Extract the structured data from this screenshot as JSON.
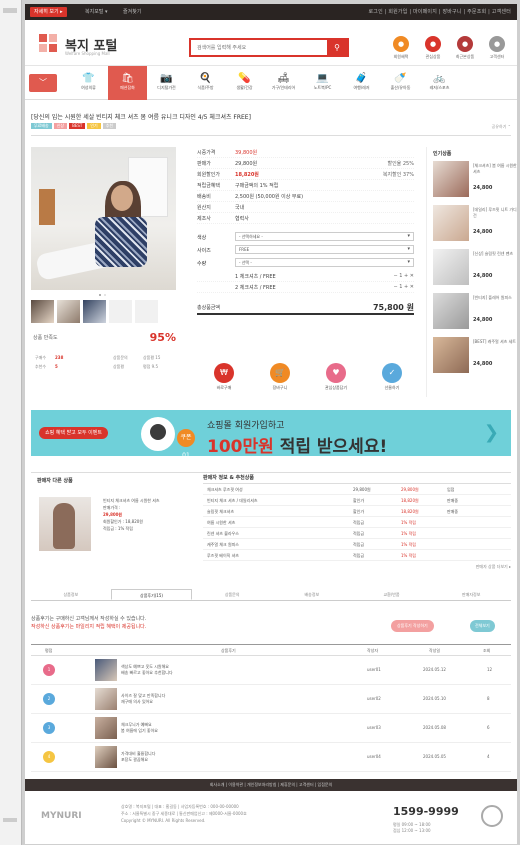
{
  "top_bar": {
    "tag": "자세히 보기 ▸",
    "left_links": [
      "복지포털 ▾",
      "즐겨찾기"
    ],
    "right_links": "로그인 | 회원가입 | 마이페이지 | 장바구니 | 주문조회 | 고객센터"
  },
  "header": {
    "brand": "복지 포털",
    "brand_sub": "Welfare Shopping Mall",
    "search_placeholder": "검색어를 입력해 주세요",
    "icons": [
      {
        "label": "회원혜택",
        "color": "#f08a24"
      },
      {
        "label": "관심상품",
        "color": "#d9342b"
      },
      {
        "label": "최근본상품",
        "color": "#b43a3a"
      },
      {
        "label": "고객센터",
        "color": "#999999"
      }
    ]
  },
  "categories": [
    "여성의류",
    "패션잡화",
    "디지털가전",
    "식품/주방",
    "생활/건강",
    "가구/인테리어",
    "노트북/PC",
    "여행/레저",
    "출산/유아동",
    "레저/스포츠"
  ],
  "product": {
    "title": "[당신의 입는 시원한 세살 빈티지 체크 셔츠 봄 여름 유니크 디자인 4/5 체크셔츠 FREE]",
    "badges": [
      {
        "text": "무료배송",
        "color": "#7fc9d4"
      },
      {
        "text": "신상",
        "color": "#f3a0a0"
      },
      {
        "text": "BEST",
        "color": "#d9342b"
      },
      {
        "text": "인기",
        "color": "#f5c542"
      },
      {
        "text": "추천",
        "color": "#ccc"
      }
    ],
    "share": "공유하기 ⌃",
    "like_label": "상품 만족도",
    "like_pct": "95%",
    "stats": [
      {
        "k": "구매수",
        "v": "238",
        "k2": "상품문의",
        "v2": "상품평 15"
      },
      {
        "k": "추천수",
        "v": "5",
        "k2": "상품평",
        "v2": "평점 9.5"
      }
    ],
    "info_rows": [
      {
        "k": "시중가격",
        "v": "39,800원",
        "r": ""
      },
      {
        "k": "판매가",
        "v": "29,800원",
        "r": "할인율 25%"
      },
      {
        "k": "회원할인가",
        "v": "18,820원",
        "r": "복지할인 37%"
      },
      {
        "k": "적립금혜택",
        "v": "구매금액의 1% 적립",
        "r": ""
      },
      {
        "k": "배송비",
        "v": "2,500원 (50,000원 이상 무료)",
        "r": ""
      },
      {
        "k": "원산지",
        "v": "국내",
        "r": ""
      },
      {
        "k": "제조사",
        "v": "협력사",
        "r": ""
      }
    ],
    "options": [
      {
        "k": "색상",
        "v": "- 선택하세요 -"
      },
      {
        "k": "사이즈",
        "v": "FREE"
      },
      {
        "k": "수량",
        "v": "- 선택 -"
      }
    ],
    "qty_rows": [
      "1 체크셔츠 / FREE",
      "2 체크셔츠 / FREE"
    ],
    "total_label": "총상품금액",
    "total_value": "75,800 원",
    "actions": [
      {
        "label": "바로구매",
        "color": "#d9342b"
      },
      {
        "label": "장바구니",
        "color": "#f08a24"
      },
      {
        "label": "관심상품담기",
        "color": "#e86b8a"
      },
      {
        "label": "선물하기",
        "color": "#5aa9dc"
      }
    ]
  },
  "recommend": {
    "title": "인기상품",
    "items": [
      {
        "t": "[체크셔츠] 봄 여름 시원한 셔츠",
        "p": "24,800"
      },
      {
        "t": "[데일리] 루즈핏 니트 가디건",
        "p": "24,800"
      },
      {
        "t": "[신상] 슬림핏 린넨 팬츠",
        "p": "24,800"
      },
      {
        "t": "[빈티지] 플레어 원피스",
        "p": "24,800"
      },
      {
        "t": "[BEST] 캐주얼 셔츠 세트",
        "p": "24,800"
      }
    ]
  },
  "banner": {
    "pill": "쇼핑 혜택 받고 모두 이벤트",
    "coupon": "쿠폰 01",
    "line1": "쇼핑몰 회원가입하고",
    "line2_a": "100만원",
    "line2_b": " 적립 받으세요!"
  },
  "lower": {
    "title": "판매자 다른 상품",
    "desc": [
      "빈티지 체크셔츠 여름 시원한 셔츠",
      "판매가격 :",
      "29,800원",
      "회원할인가 : 18,820원",
      "적립금 : 1% 적립"
    ],
    "table_title": "판매자 정보 & 추천상품",
    "rows": [
      {
        "a": "체크셔츠 루즈핏 여성",
        "b": "29,800원",
        "c": "입점",
        "d": "29,800원"
      },
      {
        "a": "빈티지 체크 셔츠 / 데일리셔츠",
        "b": "할인가",
        "c": "판매중",
        "d": "18,820원"
      },
      {
        "a": "슬림핏 체크셔츠",
        "b": "할인가",
        "c": "판매중",
        "d": "18,820원"
      },
      {
        "a": "여름 시원한 셔츠",
        "b": "적립금",
        "c": "",
        "d": "1% 적립"
      },
      {
        "a": "린넨 셔츠 블라우스",
        "b": "적립금",
        "c": "",
        "d": "1% 적립"
      },
      {
        "a": "캐주얼 체크 원피스",
        "b": "적립금",
        "c": "",
        "d": "1% 적립"
      },
      {
        "a": "루즈핏 베이직 셔츠",
        "b": "적립금",
        "c": "",
        "d": "1% 적립"
      }
    ],
    "more": "판매자 상품 더보기 ▸"
  },
  "tabs": [
    "상품정보",
    "상품후기(15)",
    "상품문의",
    "배송정보",
    "교환/반품",
    "판매자정보"
  ],
  "notice": {
    "line1": "상품후기는 구매하신 고객님께서 작성하실 수 있습니다.",
    "line2": "작성하신 상품후기는 마일리지 적립 혜택이 제공됩니다.",
    "btn1": "상품후기 작성하기",
    "btn2": "전체보기"
  },
  "reviews": {
    "headers": [
      "평점",
      "상품후기",
      "작성자",
      "작성일",
      "조회"
    ],
    "rows": [
      {
        "av": "1",
        "color": "#e86b8a",
        "t1": "색상도 예쁘고 옷도 시원해요",
        "t2": "배송 빠르고 좋아요 추천합니다",
        "w": "user01",
        "d": "2024.05.12",
        "v": "12"
      },
      {
        "av": "2",
        "color": "#5aa9dc",
        "t1": "사이즈 잘 맞고 만족합니다",
        "t2": "재구매 의사 있어요",
        "w": "user02",
        "d": "2024.05.10",
        "v": "8"
      },
      {
        "av": "3",
        "color": "#5aa9dc",
        "t1": "체크무늬가 예뻐요",
        "t2": "봄 여름에 입기 좋아요",
        "w": "user03",
        "d": "2024.05.08",
        "v": "6"
      },
      {
        "av": "4",
        "color": "#f5c542",
        "t1": "가격대비 훌륭합니다",
        "t2": "포장도 깔끔해요",
        "w": "user04",
        "d": "2024.05.05",
        "v": "4"
      }
    ]
  },
  "footer": {
    "links": "회사소개 | 이용약관 | 개인정보처리방침 | 제휴문의 | 고객센터 | 입점문의",
    "logo": "MYNURI",
    "text": [
      "상호명 : 복지포털 | 대표 : 홍길동 | 사업자등록번호 : 000-00-00000",
      "주소 : 서울특별시 중구 세종대로 | 통신판매업신고 : 제0000-서울-0000호",
      "Copyright © MYNURI. All Rights Reserved."
    ],
    "tel": "1599-9999",
    "tel_sub": [
      "평일 09:00 ~ 18:00",
      "점심 12:00 ~ 13:00"
    ]
  }
}
